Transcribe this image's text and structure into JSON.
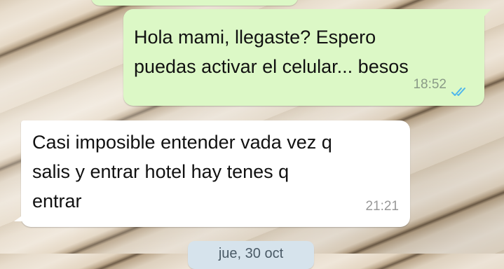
{
  "chat": {
    "messages": [
      {
        "direction": "outgoing",
        "text": "Hola mami, llegaste? Espero\npuedas activar el celular... besos",
        "time": "18:52",
        "status_icon": "double-check-read-icon",
        "bubble_color": "#dcf8c6"
      },
      {
        "direction": "incoming",
        "text": "Casi imposible entender vada vez q\nsalis y entrar hotel hay tenes q\nentrar",
        "time": "21:21",
        "bubble_color": "#ffffff"
      }
    ],
    "date_separator": "jue, 30 oct",
    "read_tick_color": "#4fb6ec"
  }
}
